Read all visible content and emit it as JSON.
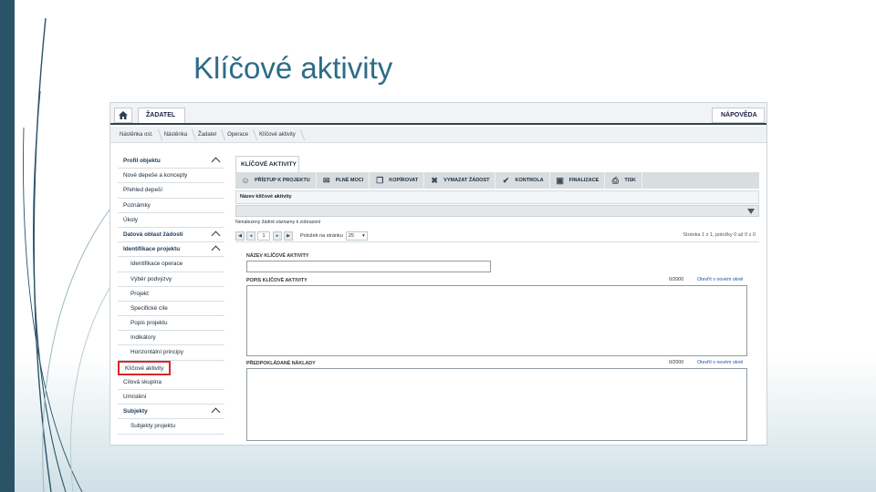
{
  "slide": {
    "title": "Klíčové aktivity"
  },
  "topbar": {
    "home_icon": "home-icon",
    "tab": "ŽADATEL",
    "help": "NÁPOVĚDA"
  },
  "breadcrumbs": [
    "Nástěnka ost.",
    "Nástěnka",
    "Žadatel",
    "Operace",
    "Klíčové aktivity"
  ],
  "nav": {
    "items": [
      {
        "label": "Profil objektu",
        "type": "head",
        "chevron": true
      },
      {
        "label": "Nové depeše a koncepty",
        "type": "item"
      },
      {
        "label": "Přehled depeší",
        "type": "item"
      },
      {
        "label": "Poznámky",
        "type": "item"
      },
      {
        "label": "Úkoly",
        "type": "item"
      },
      {
        "label": "Datová oblast žádosti",
        "type": "head",
        "chevron": true
      },
      {
        "label": "Identifikace projektu",
        "type": "head",
        "chevron": true
      },
      {
        "label": "Identifikace operace",
        "type": "sub"
      },
      {
        "label": "Výběr podvýzvy",
        "type": "sub"
      },
      {
        "label": "Projekt",
        "type": "sub"
      },
      {
        "label": "Specifické cíle",
        "type": "sub"
      },
      {
        "label": "Popis projektu",
        "type": "sub"
      },
      {
        "label": "Indikátory",
        "type": "sub"
      },
      {
        "label": "Horizontální principy",
        "type": "sub"
      },
      {
        "label": "Klíčové aktivity",
        "type": "active"
      },
      {
        "label": "Cílová skupina",
        "type": "item"
      },
      {
        "label": "Umístění",
        "type": "item"
      },
      {
        "label": "Subjekty",
        "type": "head",
        "chevron": true
      },
      {
        "label": "Subjekty projektu",
        "type": "sub"
      }
    ]
  },
  "panel": {
    "tab": "KLÍČOVÉ AKTIVITY"
  },
  "toolbar": [
    {
      "label": "PŘÍSTUP K PROJEKTU",
      "icon": "people-icon"
    },
    {
      "label": "PLNÉ MOCI",
      "icon": "mail-icon"
    },
    {
      "label": "KOPÍROVAT",
      "icon": "copy-icon"
    },
    {
      "label": "VYMAZAT ŽÁDOST",
      "icon": "delete-icon"
    },
    {
      "label": "KONTROLA",
      "icon": "check-icon"
    },
    {
      "label": "FINALIZACE",
      "icon": "lock-icon"
    },
    {
      "label": "TISK",
      "icon": "print-icon"
    }
  ],
  "table": {
    "column": "Název klíčové aktivity",
    "filter_note": "Nenalezeny žádné záznamy k zobrazení"
  },
  "pager": {
    "page": "1",
    "per_page_label": "Položek na stránku",
    "per_page": "25",
    "info": "Stránka 1 z 1, položky 0 až 0 z 0"
  },
  "form": {
    "name_label": "NÁZEV KLÍČOVÉ AKTIVITY",
    "description_label": "POPIS KLÍČOVÉ AKTIVITY",
    "description_counter": "0/2000",
    "open_link": "Otevřít v novém okně",
    "costs_label": "PŘEDPOKLÁDANÉ NÁKLADY",
    "costs_counter": "0/2000"
  },
  "colors": {
    "accent": "#2a5368",
    "title": "#2c6c88",
    "highlight": "#d42a2a"
  }
}
